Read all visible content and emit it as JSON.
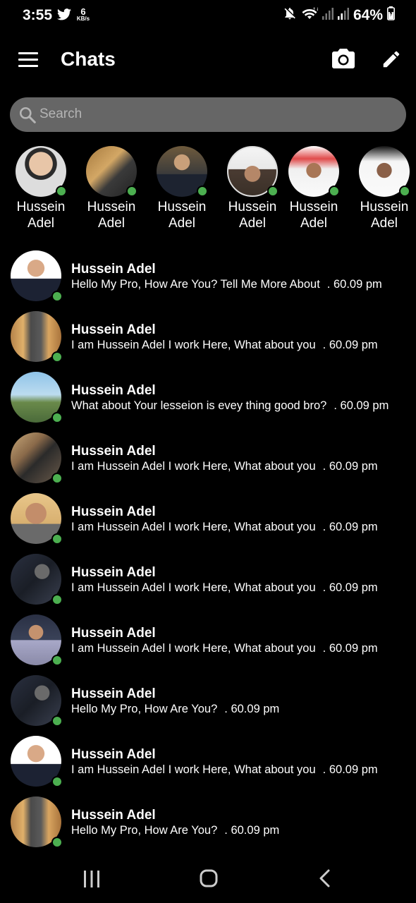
{
  "status_bar": {
    "time": "3:55",
    "net_speed_value": "6",
    "net_speed_unit": "KB/s",
    "battery": "64%",
    "icons": [
      "twitter-icon",
      "mute-icon",
      "wifi-icon",
      "signal-icon",
      "signal-icon",
      "battery-charging-icon"
    ]
  },
  "app_bar": {
    "title": "Chats",
    "icons": [
      "menu-icon",
      "camera-icon",
      "edit-icon"
    ]
  },
  "search": {
    "placeholder": "Search"
  },
  "stories": [
    {
      "first": "Hussein",
      "last": "Adel",
      "online": true
    },
    {
      "first": "Hussein",
      "last": "Adel",
      "online": true
    },
    {
      "first": "Hussein",
      "last": "Adel",
      "online": true
    },
    {
      "first": "Hussein",
      "last": "Adel",
      "online": true
    },
    {
      "first": "Hussein",
      "last": "Adel",
      "online": true
    },
    {
      "first": "Hussein",
      "last": "Adel",
      "online": true
    }
  ],
  "chats": [
    {
      "name": "Hussein Adel",
      "message": "Hello My Pro, How Are You? Tell Me More About",
      "time": ". 60.09 pm",
      "online": true
    },
    {
      "name": "Hussein Adel",
      "message": "I am Hussein Adel I work Here, What about you",
      "time": ". 60.09 pm",
      "online": true
    },
    {
      "name": "Hussein Adel",
      "message": "What about Your lesseion is evey thing good bro?",
      "time": ". 60.09 pm",
      "online": true
    },
    {
      "name": "Hussein Adel",
      "message": "I am Hussein Adel I work Here, What about you",
      "time": ". 60.09 pm",
      "online": true
    },
    {
      "name": "Hussein Adel",
      "message": "I am Hussein Adel I work Here, What about you",
      "time": ". 60.09 pm",
      "online": true
    },
    {
      "name": "Hussein Adel",
      "message": "I am Hussein Adel I work Here, What about you",
      "time": ". 60.09 pm",
      "online": true
    },
    {
      "name": "Hussein Adel",
      "message": "I am Hussein Adel I work Here, What about you",
      "time": ". 60.09 pm",
      "online": true
    },
    {
      "name": "Hussein Adel",
      "message": "Hello My Pro, How Are You?",
      "time": ". 60.09 pm",
      "online": true
    },
    {
      "name": "Hussein Adel",
      "message": "I am Hussein Adel I work Here, What about you",
      "time": ". 60.09 pm",
      "online": true
    },
    {
      "name": "Hussein Adel",
      "message": "Hello My Pro, How Are You?",
      "time": ". 60.09 pm",
      "online": true
    }
  ],
  "nav_bar": {
    "icons": [
      "recent-apps-icon",
      "home-icon",
      "back-icon"
    ]
  },
  "colors": {
    "background": "#000000",
    "search_bg": "#666666",
    "online": "#4caf50",
    "text": "#ffffff"
  }
}
